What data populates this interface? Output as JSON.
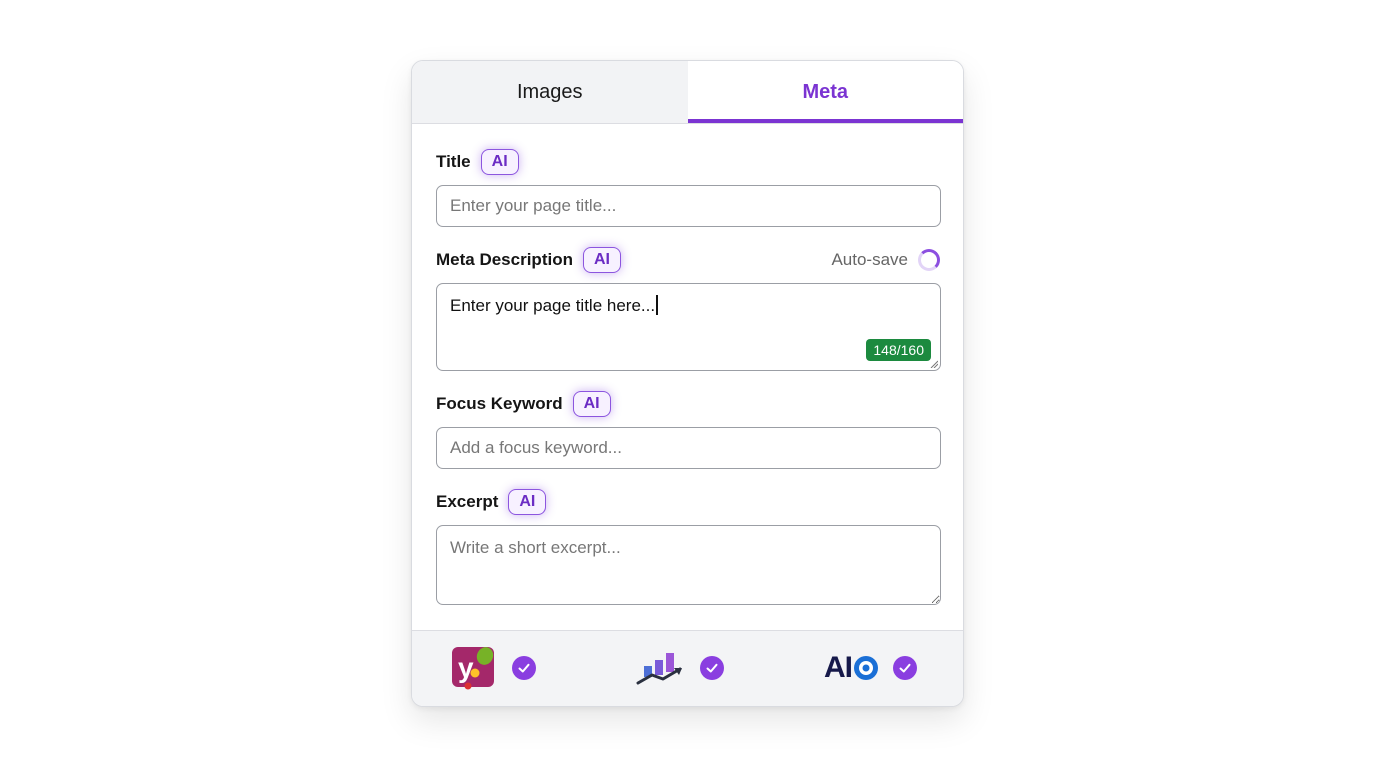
{
  "tabs": [
    {
      "label": "Images",
      "active": false
    },
    {
      "label": "Meta",
      "active": true
    }
  ],
  "ai_badge": "AI",
  "fields": {
    "title": {
      "label": "Title",
      "placeholder": "Enter your page title..."
    },
    "meta_description": {
      "label": "Meta Description",
      "value": "Enter your page title here...",
      "counter": "148/160"
    },
    "focus_keyword": {
      "label": "Focus Keyword",
      "placeholder": "Add a focus keyword..."
    },
    "excerpt": {
      "label": "Excerpt",
      "placeholder": "Write a short excerpt..."
    }
  },
  "autosave": {
    "label": "Auto-save"
  },
  "plugins": [
    {
      "name": "yoast-logo-icon",
      "verified": true
    },
    {
      "name": "rank-chart-logo-icon",
      "verified": true
    },
    {
      "name": "aioseo-logo",
      "logo_text": "AI",
      "verified": true
    }
  ],
  "colors": {
    "accent": "#7b34d2",
    "counter_bg": "#1c8a3f",
    "check": "#8a3ee0"
  }
}
